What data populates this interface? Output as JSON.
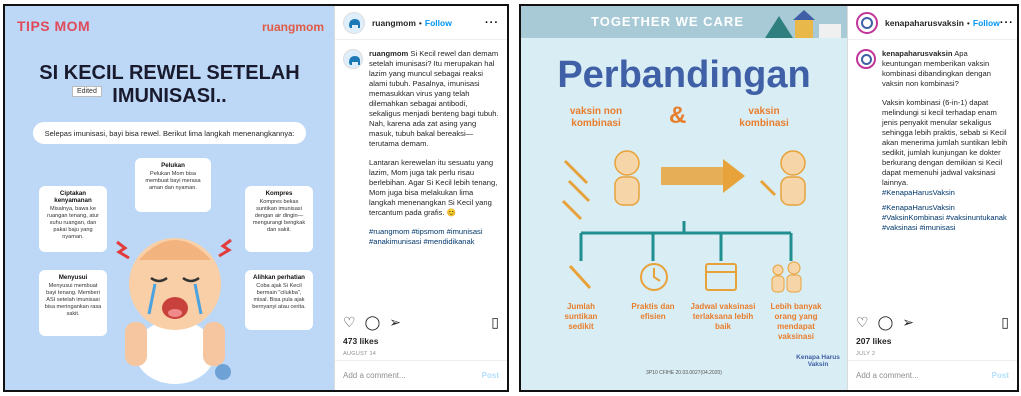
{
  "post1": {
    "image": {
      "tips_logo": "TIPS MOM",
      "brand_logo": "ruangmom",
      "title": "SI KECIL REWEL SETELAH IMUNISASI..",
      "edited_badge": "Edited",
      "intro": "Selepas imunisasi, bayi bisa rewel. Berikut lima langkah menenangkannya:",
      "tips": [
        {
          "title": "Pelukan",
          "body": "Pelukan Mom bisa membuat bayi merasa aman dan nyaman."
        },
        {
          "title": "Ciptakan kenyamanan",
          "body": "Misalnya, bawa ke ruangan tenang, atur suhu ruangan, dan pakai baju yang nyaman."
        },
        {
          "title": "Kompres",
          "body": "Kompres bekas suntikan imunisasi dengan air dingin—mengurangi bengkak dan sakit."
        },
        {
          "title": "Menyusui",
          "body": "Menyusui membuat bayi tenang. Memberi ASI setelah imunisasi bisa meringankan rasa sakit."
        },
        {
          "title": "Alihkan perhatian",
          "body": "Coba ajak Si Kecil bermain \"cilukba\", misal. Bisa pula ajak bernyanyi atau cerita."
        }
      ]
    },
    "username": "ruangmom",
    "follow_label": "Follow",
    "caption_paragraphs": [
      "Si Kecil rewel dan demam setelah imunisasi? Itu merupakan hal lazim yang muncul sebagai reaksi alami tubuh. Pasalnya, imunisasi memasukkan virus yang telah dilemahkan sebagai antibodi, sekaligus menjadi benteng bagi tubuh. Nah, karena ada zat asing yang masuk, tubuh bakal bereaksi—terutama demam.",
      "Lantaran kerewelan itu sesuatu yang lazim, Mom juga tak perlu risau berlebihan. Agar Si Kecil lebih tenang, Mom juga bisa melakukan lima langkah menenangkan Si Kecil yang tercantum pada grafis. 😊"
    ],
    "hashtags": "#ruangmom #tipsmom #imunisasi #anakimunisasi #mendidikanak",
    "likes": "473 likes",
    "date": "AUGUST 14",
    "comment_placeholder": "Add a comment...",
    "post_label": "Post"
  },
  "post2": {
    "image": {
      "banner": "TOGETHER WE CARE",
      "title": "Perbandingan",
      "amp": "&",
      "left_label": "vaksin non kombinasi",
      "right_label": "vaksin kombinasi",
      "benefits": [
        "Jumlah suntikan sedikit",
        "Praktis dan efisien",
        "Jadwal vaksinasi terlaksana lebih baik",
        "Lebih banyak orang yang mendapat vaksinasi"
      ],
      "footer": "3P10 CFIHE 20.03.0027(04.2020)",
      "logo": "Kenapa Harus Vaksin"
    },
    "username": "kenapaharusvaksin",
    "follow_label": "Follow",
    "caption_paragraphs": [
      "Apa keuntungan memberikan vaksin kombinasi dibandingkan dengan vaksin non kombinasi?",
      "Vaksin kombinasi (6-in-1) dapat melindungi si kecil terhadap enam jenis penyakit menular sekaligus sehingga lebih praktis, sebab si Kecil akan menerima jumlah suntikan lebih sedikit, jumlah kunjungan ke dokter berkurang dengan demikian si Kecil dapat memenuhi jadwal vaksinasi lainnya."
    ],
    "hashtag_main": "#KenapaHarusVaksin",
    "hashtags": "#KenapaHarusVaksin #VaksinKombinasi #vaksinuntukanak #vaksinasi #imunisasi",
    "likes": "207 likes",
    "date": "JULY 2",
    "comment_placeholder": "Add a comment...",
    "post_label": "Post"
  },
  "colors": {
    "follow": "#0095f6",
    "tips_red": "#e14a5b",
    "kv_blue": "#3f5fa6",
    "kv_orange": "#e87d2c",
    "kv_teal": "#1f8f8f"
  }
}
